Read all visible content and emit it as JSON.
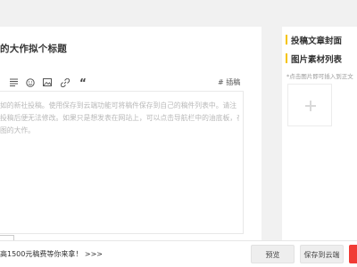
{
  "editor": {
    "title_placeholder": "的大作拟个标题",
    "toolbar": {
      "tag_label": "# 插稿"
    },
    "content_placeholder_lines": [
      "如的新社投稿。使用保存到云端功能可将稿件保存到自己的稿件列表中。请注",
      "投稿后便无法修改。如果只是想发表在网站上，可以点击导航栏中的油底板，在",
      "图的大作。"
    ]
  },
  "sidebar": {
    "cover_heading": "投稿文章封面",
    "materials_heading": "图片素材列表",
    "upload_note": "*点击图片即可插入到正文"
  },
  "footer": {
    "promo_text": "高1500元稿费等你来拿！ >>>",
    "preview_button": "预览",
    "save_button": "保存到云端",
    "publish_color": "#f13b35"
  },
  "icons": [
    "align-icon",
    "emoji-icon",
    "image-icon",
    "link-icon",
    "quote-icon"
  ]
}
